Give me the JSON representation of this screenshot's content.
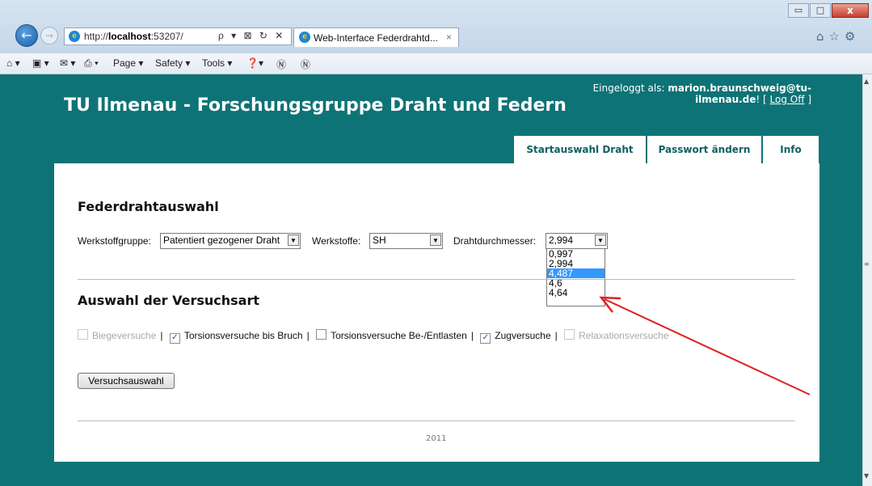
{
  "browser": {
    "url_prefix": "http://",
    "url_host": "localhost",
    "url_rest": ":53207/",
    "address_tools": "ρ ▾ ⊠ ↻ ✕",
    "tab_title": "Web-Interface Federdrahtd...",
    "tab_close": "×",
    "commands": [
      "Page ▾",
      "Safety ▾",
      "Tools ▾"
    ],
    "window_buttons": {
      "min": "▭",
      "max": "□",
      "close": "x"
    },
    "right_icons": "⌂☆⚙"
  },
  "header": {
    "title": "TU Ilmenau - Forschungsgruppe Draht und Federn",
    "login_prefix": "Eingeloggt als: ",
    "login_user": "marion.braunschweig@tu-ilmenau.de",
    "login_suffix": "! [ ",
    "logoff": "Log Off",
    "login_end": " ]"
  },
  "nav": {
    "start": "Startauswahl Draht",
    "password": "Passwort ändern",
    "info": "Info"
  },
  "federdraht": {
    "heading": "Federdrahtauswahl",
    "werkstoffgruppe_label": "Werkstoffgruppe:",
    "werkstoffgruppe_value": "Patentiert gezogener Draht",
    "werkstoffe_label": "Werkstoffe:",
    "werkstoffe_value": "SH",
    "durchmesser_label": "Drahtdurchmesser:",
    "durchmesser_value": "2,994",
    "durchmesser_options": [
      "0,997",
      "2,994",
      "4,487",
      "4,6",
      "4,64"
    ],
    "highlighted_option": "4,487"
  },
  "versuch": {
    "heading": "Auswahl der Versuchsart",
    "checks": [
      {
        "label": "Biegeversuche",
        "checked": false,
        "disabled": true
      },
      {
        "label": "Torsionsversuche bis Bruch",
        "checked": true,
        "disabled": false
      },
      {
        "label": "Torsionsversuche Be-/Entlasten",
        "checked": false,
        "disabled": false
      },
      {
        "label": "Zugversuche",
        "checked": true,
        "disabled": false
      },
      {
        "label": "Relaxationsversuche",
        "checked": false,
        "disabled": true
      }
    ],
    "button": "Versuchsauswahl"
  },
  "footer": {
    "year": "2011"
  },
  "colors": {
    "page_bg": "#0e7376",
    "annotation_arrow": "#e02020",
    "highlight": "#3399ff"
  }
}
